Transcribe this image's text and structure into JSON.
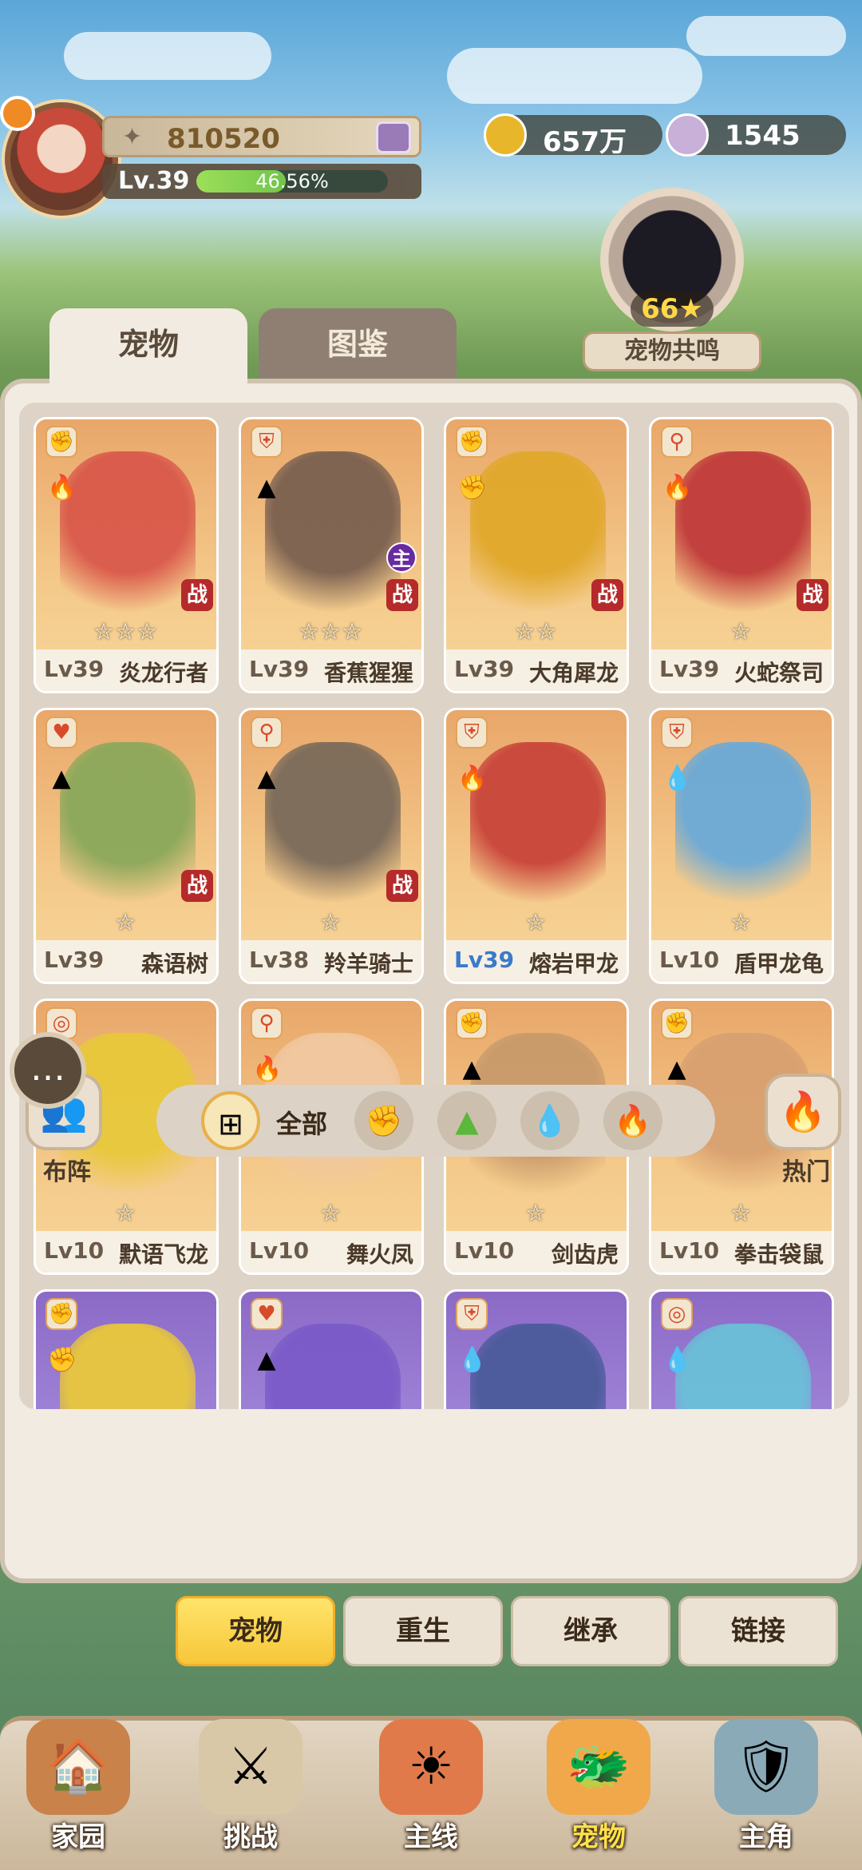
{
  "header": {
    "power": "810520",
    "level": "Lv.39",
    "exp_percent_text": "46.56%",
    "exp_fraction": 0.4656,
    "gold": "657万",
    "shells": "1545"
  },
  "resonance": {
    "count": "66",
    "label": "宠物共鸣"
  },
  "tabs": {
    "pets": "宠物",
    "book": "图鉴"
  },
  "cards": [
    {
      "lv": "Lv39",
      "name": "炎龙行者",
      "stars": "☆☆☆",
      "role": "✊",
      "elem": "🔥",
      "tag": "战",
      "color": "#d9584a",
      "lv_color": "#6a5a4a"
    },
    {
      "lv": "Lv39",
      "name": "香蕉猩猩",
      "stars": "☆☆☆",
      "role": "⛨",
      "elem": "▲",
      "tag": "战",
      "main": "主",
      "color": "#7a6050",
      "lv_color": "#6a5a4a"
    },
    {
      "lv": "Lv39",
      "name": "大角犀龙",
      "stars": "☆☆",
      "role": "✊",
      "elem": "✊",
      "tag": "战",
      "color": "#e0a82a",
      "lv_color": "#6a5a4a"
    },
    {
      "lv": "Lv39",
      "name": "火蛇祭司",
      "stars": "☆",
      "role": "⚲",
      "elem": "🔥",
      "tag": "战",
      "color": "#c03a3a",
      "lv_color": "#6a5a4a"
    },
    {
      "lv": "Lv39",
      "name": "森语树",
      "stars": "☆",
      "role": "♥",
      "elem": "▲",
      "tag": "战",
      "color": "#8aa85a",
      "lv_color": "#6a5a4a"
    },
    {
      "lv": "Lv38",
      "name": "羚羊骑士",
      "stars": "☆",
      "role": "⚲",
      "elem": "▲",
      "tag": "战",
      "color": "#7a6a5a",
      "lv_color": "#6a5a4a"
    },
    {
      "lv": "Lv39",
      "name": "熔岩甲龙",
      "stars": "☆",
      "role": "⛨",
      "elem": "🔥",
      "tag": "",
      "color": "#c8443a",
      "lv_color": "#3a7ac8"
    },
    {
      "lv": "Lv10",
      "name": "盾甲龙龟",
      "stars": "☆",
      "role": "⛨",
      "elem": "💧",
      "tag": "",
      "color": "#6aaad8",
      "lv_color": "#6a5a4a"
    },
    {
      "lv": "Lv10",
      "name": "默语飞龙",
      "stars": "☆",
      "role": "◎",
      "elem": "▲",
      "tag": "",
      "color": "#e8c83a",
      "lv_color": "#6a5a4a"
    },
    {
      "lv": "Lv10",
      "name": "舞火凤",
      "stars": "☆",
      "role": "⚲",
      "elem": "🔥",
      "tag": "",
      "color": "#f0c8a0",
      "lv_color": "#6a5a4a"
    },
    {
      "lv": "Lv10",
      "name": "剑齿虎",
      "stars": "☆",
      "role": "✊",
      "elem": "▲",
      "tag": "",
      "color": "#c89a6a",
      "lv_color": "#6a5a4a"
    },
    {
      "lv": "Lv10",
      "name": "拳击袋鼠",
      "stars": "☆",
      "role": "✊",
      "elem": "▲",
      "tag": "",
      "color": "#d8a070",
      "lv_color": "#6a5a4a"
    },
    {
      "lv": "",
      "name": "",
      "stars": "",
      "role": "✊",
      "elem": "✊",
      "tag": "",
      "color": "#e8c83a",
      "lv_color": "#6a5a4a",
      "purple": true
    },
    {
      "lv": "",
      "name": "",
      "stars": "",
      "role": "♥",
      "elem": "▲",
      "tag": "",
      "color": "#7a5ac8",
      "lv_color": "#6a5a4a",
      "purple": true
    },
    {
      "lv": "",
      "name": "",
      "stars": "",
      "role": "⛨",
      "elem": "💧",
      "tag": "",
      "color": "#4a5a9a",
      "lv_color": "#6a5a4a",
      "purple": true
    },
    {
      "lv": "",
      "name": "",
      "stars": "",
      "role": "◎",
      "elem": "💧",
      "tag": "",
      "color": "#6ac0d8",
      "lv_color": "#6a5a4a",
      "purple": true
    }
  ],
  "filters": {
    "formation": "布阵",
    "all": "全部",
    "hot": "热门",
    "icons": [
      "✊",
      "▲",
      "💧",
      "🔥"
    ]
  },
  "sub_tabs": [
    "宠物",
    "重生",
    "继承",
    "链接"
  ],
  "nav": [
    {
      "label": "家园",
      "icon": "🏠"
    },
    {
      "label": "挑战",
      "icon": "⚔"
    },
    {
      "label": "主线",
      "icon": "☀"
    },
    {
      "label": "宠物",
      "icon": "🐲",
      "active": true
    },
    {
      "label": "主角",
      "icon": "🛡"
    }
  ],
  "colors": {
    "accent": "#f7c63a",
    "panel": "#f1ebe2",
    "card_orange": "#f4c98a",
    "card_purple": "#a48adc"
  }
}
